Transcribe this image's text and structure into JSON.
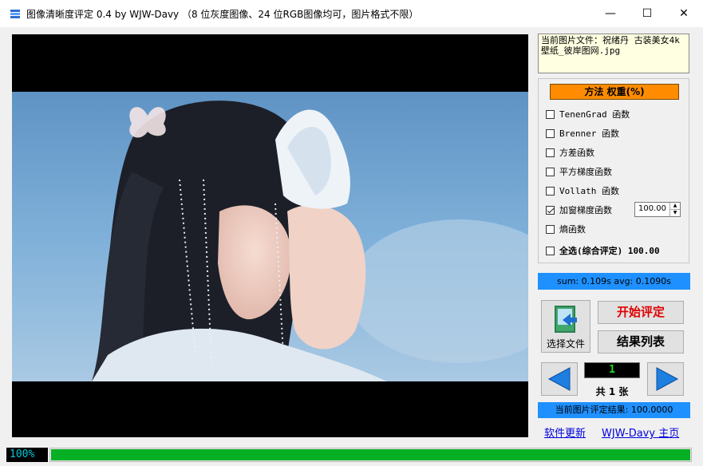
{
  "window": {
    "title": "图像清晰度评定 0.4 by WJW-Davy  （8 位灰度图像、24 位RGB图像均可，图片格式不限）",
    "minimize_glyph": "—",
    "maximize_glyph": "☐",
    "close_glyph": "✕"
  },
  "image_panel": {
    "description_icon": "photo"
  },
  "file_info": {
    "text": "当前图片文件：祝绪丹 古装美女4k壁纸_彼岸图网.jpg"
  },
  "methods": {
    "header": "方法   权重(%)",
    "items": [
      {
        "label": "TenenGrad 函数",
        "checked": false
      },
      {
        "label": "Brenner 函数",
        "checked": false
      },
      {
        "label": "方差函数",
        "checked": false
      },
      {
        "label": "平方梯度函数",
        "checked": false
      },
      {
        "label": "Vollath 函数",
        "checked": false
      },
      {
        "label": "加窗梯度函数",
        "checked": true
      },
      {
        "label": "熵函数",
        "checked": false
      }
    ],
    "select_all_label": "全选(综合评定) 100.00",
    "weight_value": "100.00"
  },
  "timing": {
    "text": "sum: 0.109s  avg: 0.1090s"
  },
  "buttons": {
    "select_file": "选择文件",
    "start": "开始评定",
    "results": "结果列表"
  },
  "navigation": {
    "current_index": "1",
    "total_label": "共 1 张"
  },
  "result": {
    "text": "当前图片评定结果: 100.0000"
  },
  "links": {
    "update": "软件更新",
    "home": "WJW-Davy 主页"
  },
  "status": {
    "percent_text": "100%",
    "progress_fraction": 1.0
  },
  "colors": {
    "accent_blue": "#1e90ff",
    "header_orange": "#ff8c00",
    "progress_green": "#06b025",
    "start_red": "#e00000"
  }
}
